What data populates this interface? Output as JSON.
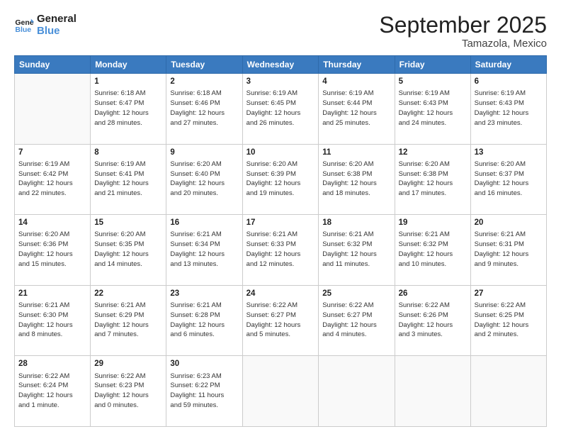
{
  "logo": {
    "line1": "General",
    "line2": "Blue"
  },
  "title": "September 2025",
  "subtitle": "Tamazola, Mexico",
  "days_header": [
    "Sunday",
    "Monday",
    "Tuesday",
    "Wednesday",
    "Thursday",
    "Friday",
    "Saturday"
  ],
  "weeks": [
    [
      {
        "day": "",
        "info": ""
      },
      {
        "day": "1",
        "info": "Sunrise: 6:18 AM\nSunset: 6:47 PM\nDaylight: 12 hours\nand 28 minutes."
      },
      {
        "day": "2",
        "info": "Sunrise: 6:18 AM\nSunset: 6:46 PM\nDaylight: 12 hours\nand 27 minutes."
      },
      {
        "day": "3",
        "info": "Sunrise: 6:19 AM\nSunset: 6:45 PM\nDaylight: 12 hours\nand 26 minutes."
      },
      {
        "day": "4",
        "info": "Sunrise: 6:19 AM\nSunset: 6:44 PM\nDaylight: 12 hours\nand 25 minutes."
      },
      {
        "day": "5",
        "info": "Sunrise: 6:19 AM\nSunset: 6:43 PM\nDaylight: 12 hours\nand 24 minutes."
      },
      {
        "day": "6",
        "info": "Sunrise: 6:19 AM\nSunset: 6:43 PM\nDaylight: 12 hours\nand 23 minutes."
      }
    ],
    [
      {
        "day": "7",
        "info": "Sunrise: 6:19 AM\nSunset: 6:42 PM\nDaylight: 12 hours\nand 22 minutes."
      },
      {
        "day": "8",
        "info": "Sunrise: 6:19 AM\nSunset: 6:41 PM\nDaylight: 12 hours\nand 21 minutes."
      },
      {
        "day": "9",
        "info": "Sunrise: 6:20 AM\nSunset: 6:40 PM\nDaylight: 12 hours\nand 20 minutes."
      },
      {
        "day": "10",
        "info": "Sunrise: 6:20 AM\nSunset: 6:39 PM\nDaylight: 12 hours\nand 19 minutes."
      },
      {
        "day": "11",
        "info": "Sunrise: 6:20 AM\nSunset: 6:38 PM\nDaylight: 12 hours\nand 18 minutes."
      },
      {
        "day": "12",
        "info": "Sunrise: 6:20 AM\nSunset: 6:38 PM\nDaylight: 12 hours\nand 17 minutes."
      },
      {
        "day": "13",
        "info": "Sunrise: 6:20 AM\nSunset: 6:37 PM\nDaylight: 12 hours\nand 16 minutes."
      }
    ],
    [
      {
        "day": "14",
        "info": "Sunrise: 6:20 AM\nSunset: 6:36 PM\nDaylight: 12 hours\nand 15 minutes."
      },
      {
        "day": "15",
        "info": "Sunrise: 6:20 AM\nSunset: 6:35 PM\nDaylight: 12 hours\nand 14 minutes."
      },
      {
        "day": "16",
        "info": "Sunrise: 6:21 AM\nSunset: 6:34 PM\nDaylight: 12 hours\nand 13 minutes."
      },
      {
        "day": "17",
        "info": "Sunrise: 6:21 AM\nSunset: 6:33 PM\nDaylight: 12 hours\nand 12 minutes."
      },
      {
        "day": "18",
        "info": "Sunrise: 6:21 AM\nSunset: 6:32 PM\nDaylight: 12 hours\nand 11 minutes."
      },
      {
        "day": "19",
        "info": "Sunrise: 6:21 AM\nSunset: 6:32 PM\nDaylight: 12 hours\nand 10 minutes."
      },
      {
        "day": "20",
        "info": "Sunrise: 6:21 AM\nSunset: 6:31 PM\nDaylight: 12 hours\nand 9 minutes."
      }
    ],
    [
      {
        "day": "21",
        "info": "Sunrise: 6:21 AM\nSunset: 6:30 PM\nDaylight: 12 hours\nand 8 minutes."
      },
      {
        "day": "22",
        "info": "Sunrise: 6:21 AM\nSunset: 6:29 PM\nDaylight: 12 hours\nand 7 minutes."
      },
      {
        "day": "23",
        "info": "Sunrise: 6:21 AM\nSunset: 6:28 PM\nDaylight: 12 hours\nand 6 minutes."
      },
      {
        "day": "24",
        "info": "Sunrise: 6:22 AM\nSunset: 6:27 PM\nDaylight: 12 hours\nand 5 minutes."
      },
      {
        "day": "25",
        "info": "Sunrise: 6:22 AM\nSunset: 6:27 PM\nDaylight: 12 hours\nand 4 minutes."
      },
      {
        "day": "26",
        "info": "Sunrise: 6:22 AM\nSunset: 6:26 PM\nDaylight: 12 hours\nand 3 minutes."
      },
      {
        "day": "27",
        "info": "Sunrise: 6:22 AM\nSunset: 6:25 PM\nDaylight: 12 hours\nand 2 minutes."
      }
    ],
    [
      {
        "day": "28",
        "info": "Sunrise: 6:22 AM\nSunset: 6:24 PM\nDaylight: 12 hours\nand 1 minute."
      },
      {
        "day": "29",
        "info": "Sunrise: 6:22 AM\nSunset: 6:23 PM\nDaylight: 12 hours\nand 0 minutes."
      },
      {
        "day": "30",
        "info": "Sunrise: 6:23 AM\nSunset: 6:22 PM\nDaylight: 11 hours\nand 59 minutes."
      },
      {
        "day": "",
        "info": ""
      },
      {
        "day": "",
        "info": ""
      },
      {
        "day": "",
        "info": ""
      },
      {
        "day": "",
        "info": ""
      }
    ]
  ]
}
